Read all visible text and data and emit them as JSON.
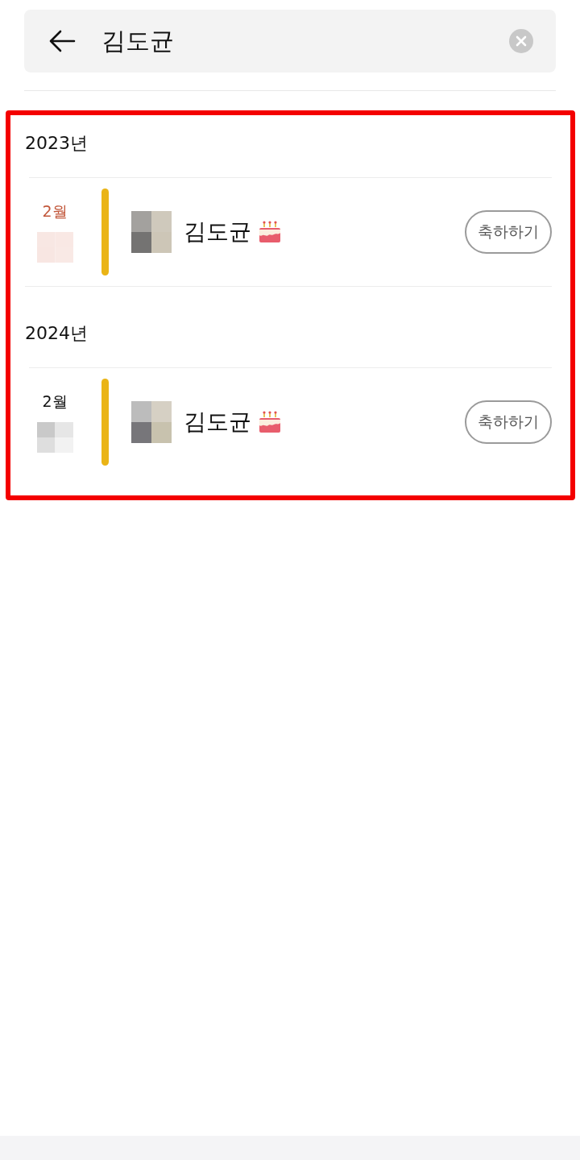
{
  "search": {
    "value": "김도균"
  },
  "groups": [
    {
      "year": "2023년",
      "entries": [
        {
          "month": "2월",
          "highlighted": true,
          "name": "김도균",
          "button": "축하하기"
        }
      ]
    },
    {
      "year": "2024년",
      "entries": [
        {
          "month": "2월",
          "highlighted": false,
          "name": "김도균",
          "button": "축하하기"
        }
      ]
    }
  ]
}
